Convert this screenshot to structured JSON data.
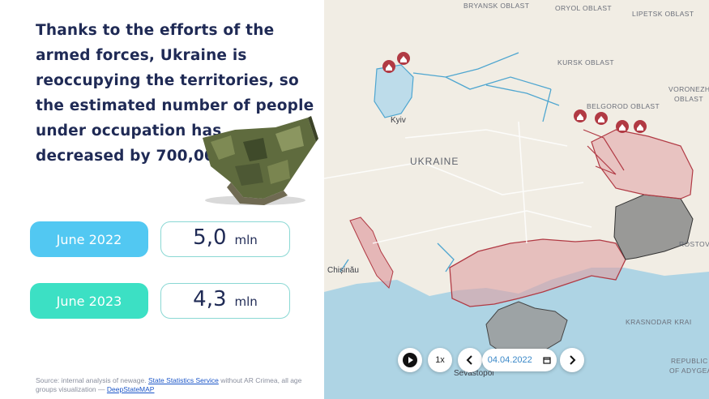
{
  "headline": "Thanks to the efforts of the armed forces, Ukraine is reoccupying the territories, so the estimated number of people under occupation has decreased by 700,000.",
  "rows": [
    {
      "date": "June 2022",
      "value": "5,0",
      "unit": "mln",
      "color": "#52c8f2"
    },
    {
      "date": "June 2023",
      "value": "4,3",
      "unit": "mln",
      "color": "#3ce0c4"
    }
  ],
  "source": {
    "prefix": "Source: internal analysis of newage.",
    "link1": "State Statistics Service",
    "middle": "without AR Crimea, all age groups visualization —",
    "link2": "DeepStateMAP"
  },
  "map": {
    "labels": {
      "bryansk": "BRYANSK OBLAST",
      "oryol": "ORYOL OBLAST",
      "lipetsk": "LIPETSK OBLAST",
      "kursk": "KURSK OBLAST",
      "voronezh1": "VORONEZH",
      "voronezh2": "OBLAST",
      "belgorod": "BELGOROD OBLAST",
      "ukraine": "UKRAINE",
      "rostov": "ROSTOV",
      "krasnodar": "KRASNODAR KRAI",
      "republic1": "REPUBLIC",
      "republic2": "OF ADYGEA",
      "kyiv": "Kyiv",
      "chisinau": "Chișinău",
      "sevastopol": "Sevastopol"
    },
    "controls": {
      "play_icon": "play-icon",
      "speed": "1x",
      "date": "04.04.2022",
      "prev_icon": "chevron-left-icon",
      "next_icon": "chevron-right-icon",
      "calendar_icon": "calendar-icon"
    }
  }
}
